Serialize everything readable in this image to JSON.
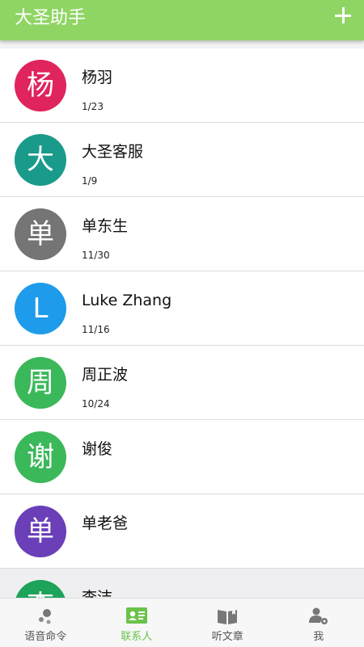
{
  "header": {
    "title": "大圣助手",
    "add_icon": "plus-icon"
  },
  "contacts": [
    {
      "initial": "杨",
      "name": "杨羽",
      "date": "1/23",
      "color": "#e0245e"
    },
    {
      "initial": "大",
      "name": "大圣客服",
      "date": "1/9",
      "color": "#1a9a8a"
    },
    {
      "initial": "单",
      "name": "单东生",
      "date": "11/30",
      "color": "#757575"
    },
    {
      "initial": "L",
      "name": "Luke Zhang",
      "date": "11/16",
      "color": "#1e9bea"
    },
    {
      "initial": "周",
      "name": "周正波",
      "date": "10/24",
      "color": "#3bb85a"
    },
    {
      "initial": "谢",
      "name": "谢俊",
      "date": "",
      "color": "#3bb85a"
    },
    {
      "initial": "单",
      "name": "单老爸",
      "date": "",
      "color": "#6a3fb8"
    },
    {
      "initial": "李",
      "name": "李洁",
      "date": "",
      "color": "#1ea35a"
    }
  ],
  "tabs": [
    {
      "label": "语音命令",
      "icon": "voice-command-icon"
    },
    {
      "label": "联系人",
      "icon": "contact-card-icon"
    },
    {
      "label": "听文章",
      "icon": "book-icon"
    },
    {
      "label": "我",
      "icon": "user-settings-icon"
    }
  ],
  "colors": {
    "accent": "#8fd563",
    "active_tab": "#6bc24a"
  }
}
